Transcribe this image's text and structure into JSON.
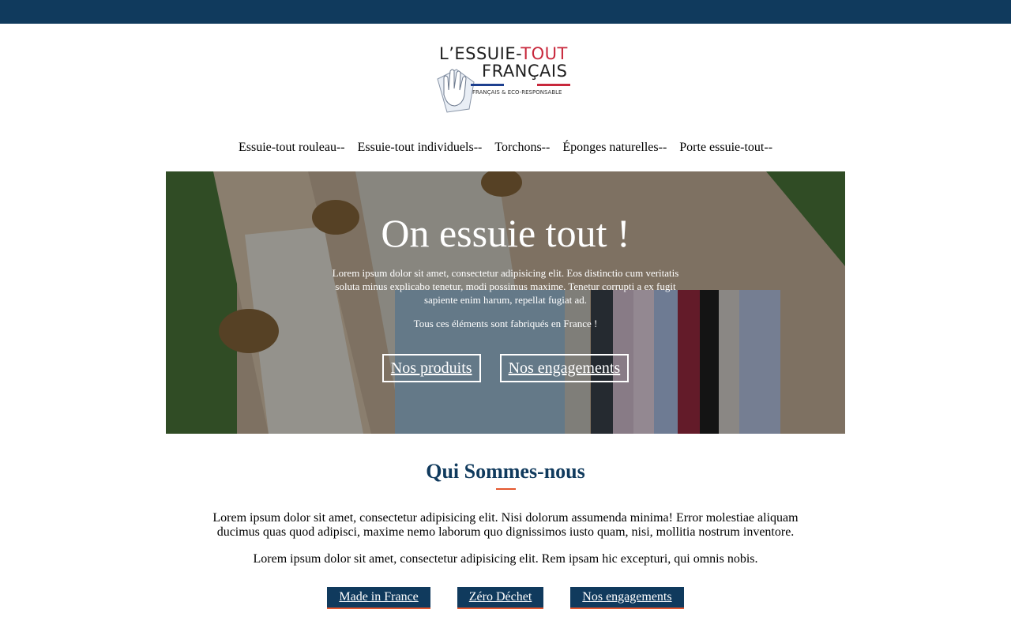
{
  "brand": {
    "logo_line1_a": "L’ESSUIE-",
    "logo_line1_b": "TOUT",
    "logo_line2": "FRANÇAIS",
    "logo_tagline": "FRANÇAIS & ECO-RESPONSABLE"
  },
  "nav": {
    "items": [
      {
        "label": "Essuie-tout rouleau--"
      },
      {
        "label": "Essuie-tout individuels--"
      },
      {
        "label": "Torchons--"
      },
      {
        "label": "Éponges naturelles--"
      },
      {
        "label": "Porte essuie-tout--"
      }
    ]
  },
  "hero": {
    "title": "On essuie tout !",
    "text": "Lorem ipsum dolor sit amet, consectetur adipisicing elit. Eos distinctio cum veritatis soluta minus explicabo tenetur, modi possimus maxime. Tenetur corrupti a ex fugit sapiente enim harum, repellat fugiat ad.",
    "subtext": "Tous ces éléments sont fabriqués en France !",
    "btn_products": "Nos produits",
    "btn_commitments": "Nos engagements"
  },
  "about": {
    "title": "Qui Sommes-nous",
    "p1": "Lorem ipsum dolor sit amet, consectetur adipisicing elit. Nisi dolorum assumenda minima! Error molestiae aliquam ducimus quas quod adipisci, maxime nemo laborum quo dignissimos iusto quam, nisi, mollitia nostrum inventore.",
    "p2": "Lorem ipsum dolor sit amet, consectetur adipisicing elit. Rem ipsam hic excepturi, qui omnis nobis.",
    "tags": [
      "Made in France",
      "Zéro Déchet",
      "Nos engagements"
    ]
  },
  "colors": {
    "navy": "#103a5d",
    "accent": "#e4572e",
    "flag_red": "#c8283c"
  }
}
